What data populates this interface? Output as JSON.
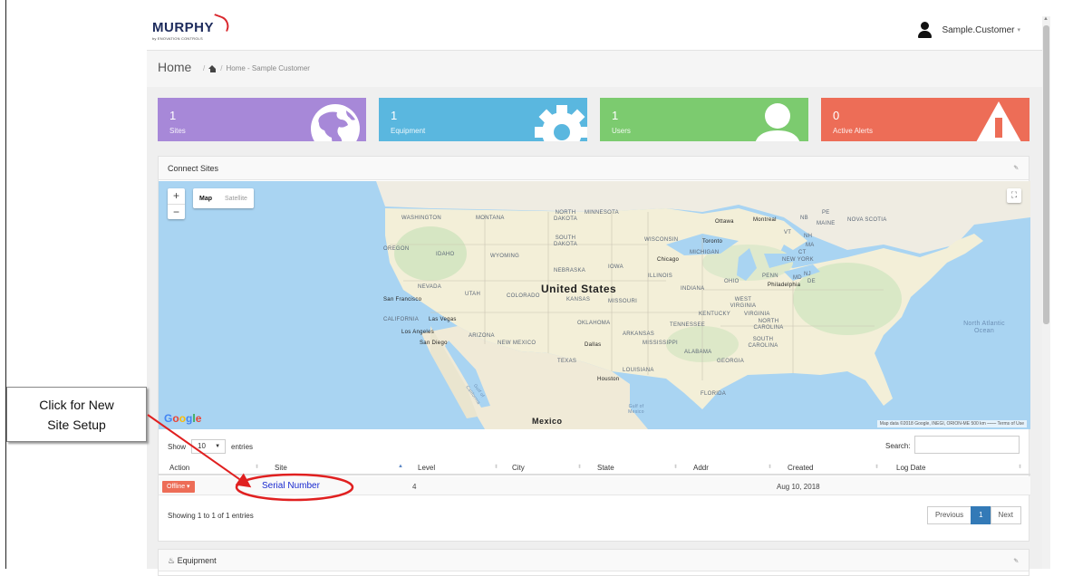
{
  "header": {
    "logo_text": "MURPHY",
    "logo_sub": "by ENOVATION CONTROLS",
    "user_name": "Sample.Customer"
  },
  "breadcrumb": {
    "title": "Home",
    "sep": "/",
    "current": "Home - Sample Customer"
  },
  "tiles": [
    {
      "count": "1",
      "label": "Sites",
      "color": "#a788d8",
      "icon": "globe-icon"
    },
    {
      "count": "1",
      "label": "Equipment",
      "color": "#5ab7df",
      "icon": "gear-icon"
    },
    {
      "count": "1",
      "label": "Users",
      "color": "#7ccb6f",
      "icon": "user-icon"
    },
    {
      "count": "0",
      "label": "Active Alerts",
      "color": "#ed6d57",
      "icon": "warning-icon"
    }
  ],
  "connect_sites": {
    "title": "Connect Sites",
    "map": {
      "type_map": "Map",
      "type_satellite": "Satellite",
      "zoom_in": "+",
      "zoom_out": "−",
      "attribution": "Map data ©2018 Google, INEGI, ORION-ME   500 km ⎯⎯⎯⎯   Terms of Use",
      "labels": {
        "washington": "WASHINGTON",
        "montana": "MONTANA",
        "north_dakota": "NORTH DAKOTA",
        "minnesota": "MINNESOTA",
        "south_dakota": "SOUTH DAKOTA",
        "oregon": "OREGON",
        "idaho": "IDAHO",
        "wyoming": "WYOMING",
        "wisconsin": "WISCONSIN",
        "michigan": "MICHIGAN",
        "nebraska": "NEBRASKA",
        "iowa": "IOWA",
        "illinois": "ILLINOIS",
        "nevada": "NEVADA",
        "utah": "UTAH",
        "colorado": "COLORADO",
        "kansas": "KANSAS",
        "missouri": "MISSOURI",
        "indiana": "INDIANA",
        "ohio": "OHIO",
        "penn": "PENN",
        "new_york": "NEW YORK",
        "california": "CALIFORNIA",
        "arizona": "ARIZONA",
        "new_mexico": "NEW MEXICO",
        "oklahoma": "OKLAHOMA",
        "arkansas": "ARKANSAS",
        "tennessee": "TENNESSEE",
        "kentucky": "KENTUCKY",
        "virginia": "VIRGINIA",
        "west_virginia": "WEST VIRGINIA",
        "north_carolina": "NORTH CAROLINA",
        "south_carolina": "SOUTH CAROLINA",
        "mississippi": "MISSISSIPPI",
        "alabama": "ALABAMA",
        "georgia": "GEORGIA",
        "texas": "TEXAS",
        "louisiana": "LOUISIANA",
        "florida": "FLORIDA",
        "united_states": "United States",
        "mexico": "Mexico",
        "gulf": "Gulf of Mexico",
        "gulf_california": "Gulf of California",
        "atlantic": "North Atlantic Ocean",
        "nova_scotia": "NOVA SCOTIA",
        "nb": "NB",
        "pe": "PE",
        "maine": "MAINE",
        "vt": "VT",
        "nh": "NH",
        "ma": "MA",
        "ct": "CT",
        "md": "MD",
        "nj": "NJ",
        "de": "DE",
        "ottawa": "Ottawa",
        "montreal": "Montreal",
        "toronto": "Toronto",
        "chicago": "Chicago",
        "philadelphia": "Philadelphia",
        "san_francisco": "San Francisco",
        "las_vegas": "Las Vegas",
        "los_angeles": "Los Angeles",
        "san_diego": "San Diego",
        "dallas": "Dallas",
        "houston": "Houston"
      }
    },
    "table": {
      "show_label": "Show",
      "page_size": "10",
      "entries_label": "entries",
      "search_label": "Search:",
      "search_value": "",
      "columns": [
        "Action",
        "Site",
        "Level",
        "City",
        "State",
        "Addr",
        "Created",
        "Log Date"
      ],
      "rows": [
        {
          "action": "Offline ▾",
          "site": "Serial Number",
          "level": "4",
          "city": "",
          "state": "",
          "addr": "",
          "created": "Aug 10, 2018",
          "log_date": ""
        }
      ],
      "info": "Showing 1 to 1 of 1 entries",
      "pager": {
        "prev": "Previous",
        "page": "1",
        "next": "Next"
      }
    }
  },
  "equipment_panel": {
    "title": "Equipment"
  },
  "annotation": {
    "callout_line1": "Click for New",
    "callout_line2": "Site Setup"
  }
}
